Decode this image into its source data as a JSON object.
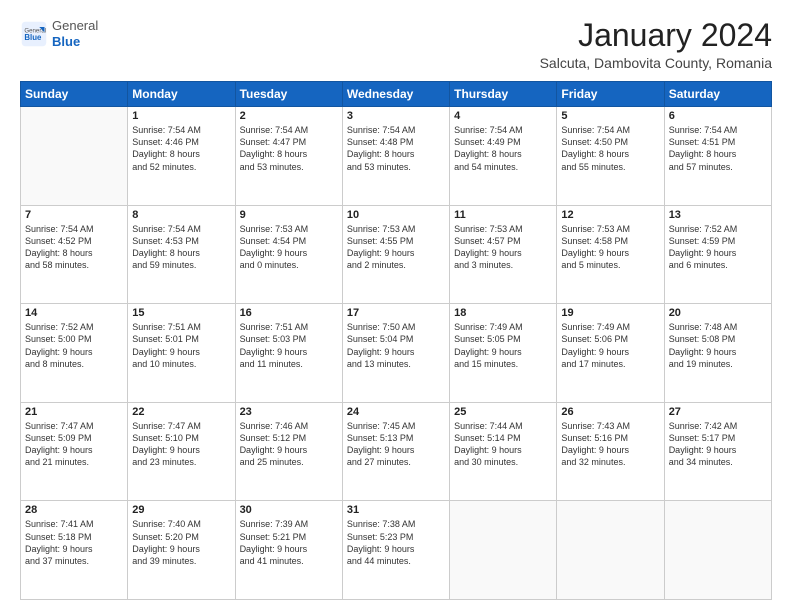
{
  "header": {
    "logo_general": "General",
    "logo_blue": "Blue",
    "month_title": "January 2024",
    "location": "Salcuta, Dambovita County, Romania"
  },
  "weekdays": [
    "Sunday",
    "Monday",
    "Tuesday",
    "Wednesday",
    "Thursday",
    "Friday",
    "Saturday"
  ],
  "weeks": [
    [
      {
        "day": "",
        "info": ""
      },
      {
        "day": "1",
        "info": "Sunrise: 7:54 AM\nSunset: 4:46 PM\nDaylight: 8 hours\nand 52 minutes."
      },
      {
        "day": "2",
        "info": "Sunrise: 7:54 AM\nSunset: 4:47 PM\nDaylight: 8 hours\nand 53 minutes."
      },
      {
        "day": "3",
        "info": "Sunrise: 7:54 AM\nSunset: 4:48 PM\nDaylight: 8 hours\nand 53 minutes."
      },
      {
        "day": "4",
        "info": "Sunrise: 7:54 AM\nSunset: 4:49 PM\nDaylight: 8 hours\nand 54 minutes."
      },
      {
        "day": "5",
        "info": "Sunrise: 7:54 AM\nSunset: 4:50 PM\nDaylight: 8 hours\nand 55 minutes."
      },
      {
        "day": "6",
        "info": "Sunrise: 7:54 AM\nSunset: 4:51 PM\nDaylight: 8 hours\nand 57 minutes."
      }
    ],
    [
      {
        "day": "7",
        "info": "Sunrise: 7:54 AM\nSunset: 4:52 PM\nDaylight: 8 hours\nand 58 minutes."
      },
      {
        "day": "8",
        "info": "Sunrise: 7:54 AM\nSunset: 4:53 PM\nDaylight: 8 hours\nand 59 minutes."
      },
      {
        "day": "9",
        "info": "Sunrise: 7:53 AM\nSunset: 4:54 PM\nDaylight: 9 hours\nand 0 minutes."
      },
      {
        "day": "10",
        "info": "Sunrise: 7:53 AM\nSunset: 4:55 PM\nDaylight: 9 hours\nand 2 minutes."
      },
      {
        "day": "11",
        "info": "Sunrise: 7:53 AM\nSunset: 4:57 PM\nDaylight: 9 hours\nand 3 minutes."
      },
      {
        "day": "12",
        "info": "Sunrise: 7:53 AM\nSunset: 4:58 PM\nDaylight: 9 hours\nand 5 minutes."
      },
      {
        "day": "13",
        "info": "Sunrise: 7:52 AM\nSunset: 4:59 PM\nDaylight: 9 hours\nand 6 minutes."
      }
    ],
    [
      {
        "day": "14",
        "info": "Sunrise: 7:52 AM\nSunset: 5:00 PM\nDaylight: 9 hours\nand 8 minutes."
      },
      {
        "day": "15",
        "info": "Sunrise: 7:51 AM\nSunset: 5:01 PM\nDaylight: 9 hours\nand 10 minutes."
      },
      {
        "day": "16",
        "info": "Sunrise: 7:51 AM\nSunset: 5:03 PM\nDaylight: 9 hours\nand 11 minutes."
      },
      {
        "day": "17",
        "info": "Sunrise: 7:50 AM\nSunset: 5:04 PM\nDaylight: 9 hours\nand 13 minutes."
      },
      {
        "day": "18",
        "info": "Sunrise: 7:49 AM\nSunset: 5:05 PM\nDaylight: 9 hours\nand 15 minutes."
      },
      {
        "day": "19",
        "info": "Sunrise: 7:49 AM\nSunset: 5:06 PM\nDaylight: 9 hours\nand 17 minutes."
      },
      {
        "day": "20",
        "info": "Sunrise: 7:48 AM\nSunset: 5:08 PM\nDaylight: 9 hours\nand 19 minutes."
      }
    ],
    [
      {
        "day": "21",
        "info": "Sunrise: 7:47 AM\nSunset: 5:09 PM\nDaylight: 9 hours\nand 21 minutes."
      },
      {
        "day": "22",
        "info": "Sunrise: 7:47 AM\nSunset: 5:10 PM\nDaylight: 9 hours\nand 23 minutes."
      },
      {
        "day": "23",
        "info": "Sunrise: 7:46 AM\nSunset: 5:12 PM\nDaylight: 9 hours\nand 25 minutes."
      },
      {
        "day": "24",
        "info": "Sunrise: 7:45 AM\nSunset: 5:13 PM\nDaylight: 9 hours\nand 27 minutes."
      },
      {
        "day": "25",
        "info": "Sunrise: 7:44 AM\nSunset: 5:14 PM\nDaylight: 9 hours\nand 30 minutes."
      },
      {
        "day": "26",
        "info": "Sunrise: 7:43 AM\nSunset: 5:16 PM\nDaylight: 9 hours\nand 32 minutes."
      },
      {
        "day": "27",
        "info": "Sunrise: 7:42 AM\nSunset: 5:17 PM\nDaylight: 9 hours\nand 34 minutes."
      }
    ],
    [
      {
        "day": "28",
        "info": "Sunrise: 7:41 AM\nSunset: 5:18 PM\nDaylight: 9 hours\nand 37 minutes."
      },
      {
        "day": "29",
        "info": "Sunrise: 7:40 AM\nSunset: 5:20 PM\nDaylight: 9 hours\nand 39 minutes."
      },
      {
        "day": "30",
        "info": "Sunrise: 7:39 AM\nSunset: 5:21 PM\nDaylight: 9 hours\nand 41 minutes."
      },
      {
        "day": "31",
        "info": "Sunrise: 7:38 AM\nSunset: 5:23 PM\nDaylight: 9 hours\nand 44 minutes."
      },
      {
        "day": "",
        "info": ""
      },
      {
        "day": "",
        "info": ""
      },
      {
        "day": "",
        "info": ""
      }
    ]
  ]
}
